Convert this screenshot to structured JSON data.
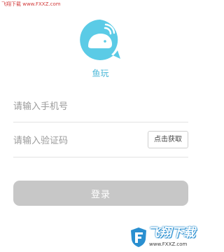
{
  "watermark_top": "飞翔下载 www.FXXZ.com",
  "app": {
    "name": "鱼玩",
    "logo_icon": "whale-chat-bubble-icon",
    "accent_color": "#5bcbe6"
  },
  "form": {
    "phone_placeholder": "请输入手机号",
    "code_placeholder": "请输入验证码",
    "get_code_label": "点击获取",
    "login_label": "登录"
  },
  "watermark_bottom": {
    "brand": "飞翔下载",
    "url": "www.FXXZ.com"
  }
}
